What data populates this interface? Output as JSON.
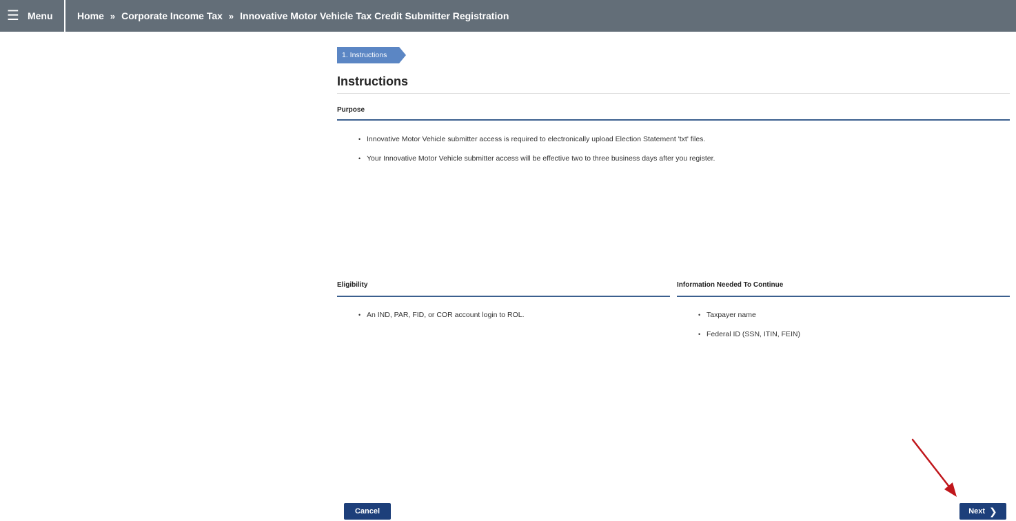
{
  "header": {
    "menu_label": "Menu",
    "breadcrumb": [
      "Home",
      "Corporate Income Tax",
      "Innovative Motor Vehicle Tax Credit Submitter Registration"
    ],
    "separator": "»"
  },
  "wizard": {
    "step_label": "1. Instructions"
  },
  "page": {
    "title": "Instructions"
  },
  "purpose": {
    "heading": "Purpose",
    "items": [
      "Innovative Motor Vehicle submitter access is required to electronically upload Election Statement 'txt' files.",
      "Your Innovative Motor Vehicle submitter access will be effective two to three business days after you register."
    ]
  },
  "eligibility": {
    "heading": "Eligibility",
    "items": [
      "An IND, PAR, FID, or COR account login to ROL."
    ]
  },
  "info_needed": {
    "heading": "Information Needed To Continue",
    "items": [
      "Taxpayer name",
      "Federal ID (SSN, ITIN, FEIN)"
    ]
  },
  "actions": {
    "cancel_label": "Cancel",
    "next_label": "Next"
  },
  "colors": {
    "topbar": "#636e78",
    "step_tab": "#5b86c4",
    "section_rule": "#3b5f8e",
    "button": "#1d3f7a",
    "annotation_arrow": "#c0161b"
  },
  "icons": {
    "menu": "hamburger-icon",
    "next": "chevron-right-icon",
    "annotation": "red-arrow-icon"
  }
}
